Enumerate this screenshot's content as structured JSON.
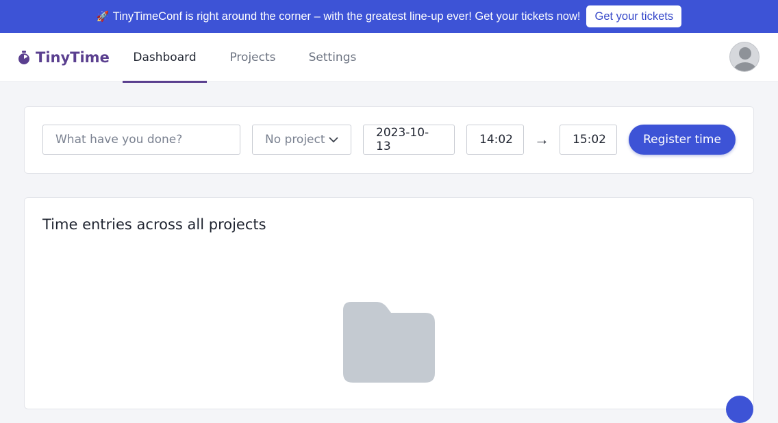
{
  "banner": {
    "rocket_icon": "rocket-icon",
    "message": "TinyTimeConf is right around the corner – with the greatest line-up ever! Get your tickets now!",
    "button_label": "Get your tickets"
  },
  "nav": {
    "brand": "TinyTime",
    "tabs": [
      {
        "label": "Dashboard",
        "active": true
      },
      {
        "label": "Projects",
        "active": false
      },
      {
        "label": "Settings",
        "active": false
      }
    ],
    "avatar_icon": "user-avatar-icon"
  },
  "entry_form": {
    "description_placeholder": "What have you done?",
    "project_value": "No project",
    "date_value": "2023-10-13",
    "start_time": "14:02",
    "arrow": "→",
    "end_time": "15:02",
    "submit_label": "Register time"
  },
  "entries": {
    "title": "Time entries across all projects",
    "empty_icon": "folder-icon"
  },
  "colors": {
    "accent": "#3d53d6",
    "brand": "#5a3f8f",
    "page_bg": "#f4f5f8"
  }
}
